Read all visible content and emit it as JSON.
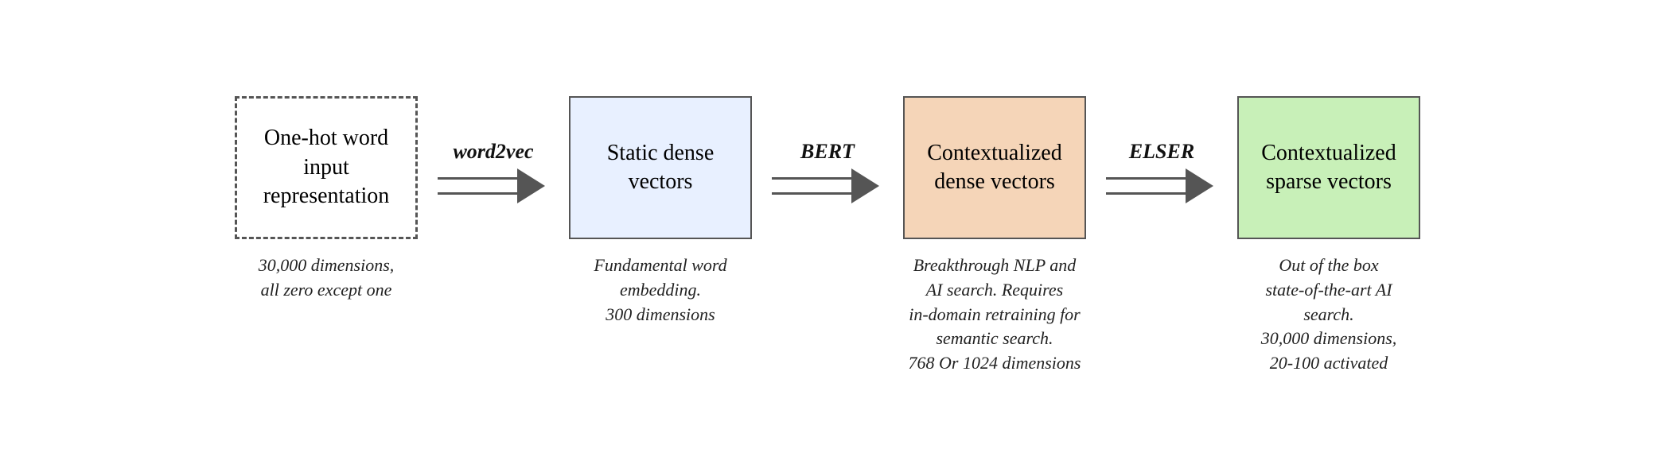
{
  "diagram": {
    "nodes": [
      {
        "id": "one-hot",
        "style": "dashed",
        "label": "One-hot word\ninput\nrepresentation",
        "sublabel": "30,000 dimensions,\nall zero except one"
      },
      {
        "id": "static-dense",
        "style": "plain",
        "label": "Static dense\nvectors",
        "sublabel": "Fundamental word\nembedding.\n300 dimensions"
      },
      {
        "id": "contextualized-dense",
        "style": "orange",
        "label": "Contextualized\ndense vectors",
        "sublabel": "Breakthrough NLP and\nAI search. Requires\nin-domain retraining for\nsemantic search.\n768 Or 1024 dimensions"
      },
      {
        "id": "contextualized-sparse",
        "style": "green",
        "label": "Contextualized\nsparse vectors",
        "sublabel": "Out of the box\nstate-of-the-art AI\nsearch.\n30,000 dimensions,\n20-100 activated"
      }
    ],
    "arrows": [
      {
        "id": "word2vec",
        "label": "word2vec"
      },
      {
        "id": "bert",
        "label": "BERT"
      },
      {
        "id": "elser",
        "label": "ELSER"
      }
    ]
  }
}
